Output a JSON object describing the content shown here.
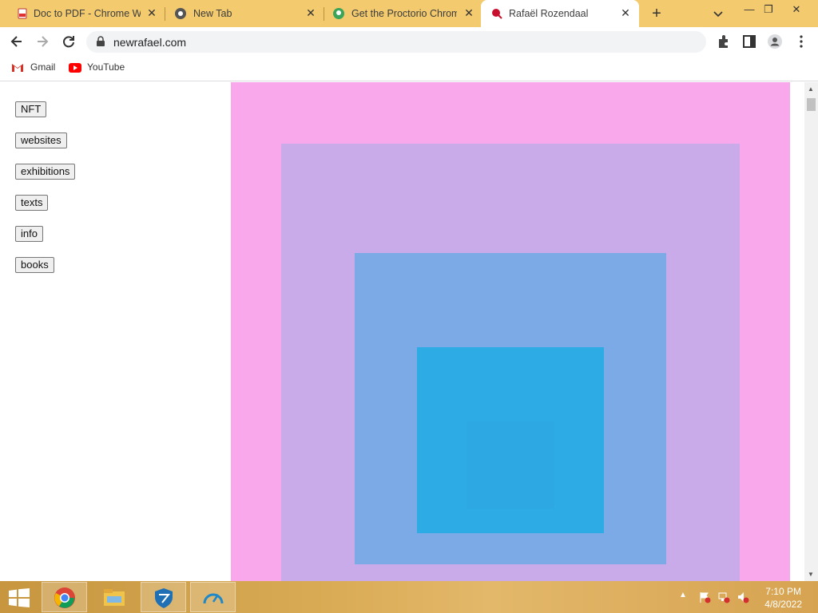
{
  "browser": {
    "tabs": [
      {
        "title": "Doc to PDF - Chrome We",
        "favicon": "docpdf-icon"
      },
      {
        "title": "New Tab",
        "favicon": "chrome-icon"
      },
      {
        "title": "Get the Proctorio Chrom",
        "favicon": "proctorio-icon"
      },
      {
        "title": "Rafaël Rozendaal",
        "favicon": "rafael-icon",
        "active": true
      }
    ],
    "url": "newrafael.com",
    "bookmarks": [
      {
        "label": "Gmail",
        "icon": "gmail-icon"
      },
      {
        "label": "YouTube",
        "icon": "youtube-icon"
      }
    ]
  },
  "page": {
    "nav": [
      "NFT",
      "websites",
      "exhibitions",
      "texts",
      "info",
      "books"
    ],
    "art_colors": {
      "background": "#f9a8ec",
      "layer1": "#c9abe9",
      "layer2": "#7baae6",
      "layer3": "#2dabe4",
      "layer4": "#2ea8e3"
    }
  },
  "taskbar": {
    "apps": [
      "chrome-icon",
      "file-explorer-icon",
      "shield-app-icon",
      "speed-gauge-icon"
    ],
    "time": "7:10 PM",
    "date": "4/8/2022"
  }
}
